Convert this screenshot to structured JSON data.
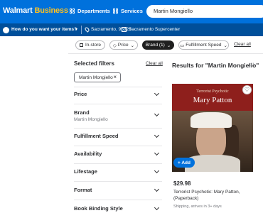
{
  "header": {
    "logo_main": "Walmart",
    "logo_accent": "Business",
    "departments": "Departments",
    "services": "Services",
    "search_value": "Martin Mongiello"
  },
  "subbar": {
    "question": "How do you want your items?",
    "location": "Sacramento, 95829",
    "store": "Sacramento Supercenter"
  },
  "filter_pills": [
    {
      "label": "In-store"
    },
    {
      "label": "Price"
    },
    {
      "label": "Brand (1)"
    },
    {
      "label": "Fulfillment Speed"
    }
  ],
  "clear_all": "Clear all",
  "sidebar": {
    "title": "Selected filters",
    "clear_all": "Clear all",
    "chip": "Martin Mongiello",
    "facets": [
      {
        "label": "Price",
        "sub": ""
      },
      {
        "label": "Brand",
        "sub": "Martin Mongiello"
      },
      {
        "label": "Fulfillment Speed",
        "sub": ""
      },
      {
        "label": "Availability",
        "sub": ""
      },
      {
        "label": "Lifestage",
        "sub": ""
      },
      {
        "label": "Format",
        "sub": ""
      },
      {
        "label": "Book Binding Style",
        "sub": ""
      }
    ]
  },
  "results": {
    "title": "Results for \"Martin Mongiello\"",
    "count": "(1)"
  },
  "product": {
    "cover_author": "Terrorist Psychotic",
    "cover_title": "Mary Patton",
    "add_label": "+ Add",
    "price": "$29.98",
    "name": "Terrorist Psychotic: Mary Patton, (Paperback)",
    "shipping": "Shipping, arrives in 3+ days"
  },
  "colors": {
    "brand_blue": "#0071dc",
    "accent_yellow": "#ffc220",
    "dark_blue": "#004f9a"
  }
}
